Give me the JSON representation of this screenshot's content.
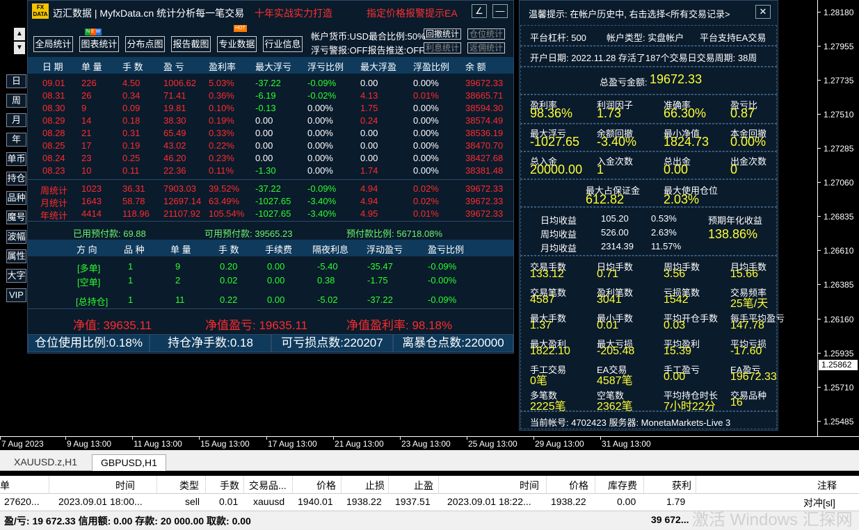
{
  "price_axis": [
    "1.28180",
    "1.27955",
    "1.27735",
    "1.27510",
    "1.27285",
    "1.27060",
    "1.26835",
    "1.26610",
    "1.26385",
    "1.26160",
    "1.25935",
    "1.25710",
    "1.25485"
  ],
  "current_price": "1.25862",
  "time_axis": [
    "7 Aug 2023",
    "9 Aug 13:00",
    "11 Aug 13:00",
    "15 Aug 13:00",
    "17 Aug 13:00",
    "21 Aug 13:00",
    "23 Aug 13:00",
    "25 Aug 13:00",
    "29 Aug 13:00",
    "31 Aug 13:00"
  ],
  "panel": {
    "logo": "FX\nDATA",
    "brand": "迈汇数据 | MyfxData.cn  统计分析每一笔交易",
    "slogan": "十年实战实力打造",
    "ea_link": "指定价格报警提示EA",
    "edit_icon": "∠",
    "min_icon": "—",
    "nav": [
      "全局统计",
      "图表统计",
      "分布点图",
      "报告截图",
      "专业数据",
      "行业信息"
    ],
    "badge_new": "N E W",
    "badge_hot": "HOT",
    "account_currency": "帐户货币:USD最合比例:50%",
    "float_alert": "浮亏警报:OFF报告推送:OFF",
    "btn_withdraw": "回撤统计",
    "btn_position": "仓位统计",
    "btn_interest": "利息统计",
    "btn_rebate": "返佣统计",
    "up_icon": "▲",
    "down_icon": "▼",
    "side": [
      "日",
      "周",
      "月",
      "年",
      "单币",
      "持仓",
      "品种",
      "魔号",
      "波幅",
      "属性",
      "大字",
      "VIP"
    ],
    "columns": [
      "日 期",
      "单 量",
      "手 数",
      "盈 亏",
      "盈利率",
      "最大浮亏",
      "浮亏比例",
      "最大浮盈",
      "浮盈比例",
      "余 额"
    ],
    "daily": [
      [
        "09.01",
        "226",
        "4.50",
        "1006.62",
        "5.03%",
        "-37.22",
        "-0.09%",
        "0.00",
        "0.00%",
        "39672.33"
      ],
      [
        "08.31",
        "26",
        "0.34",
        "71.41",
        "0.36%",
        "-6.19",
        "-0.02%",
        "4.13",
        "0.01%",
        "38665.71"
      ],
      [
        "08.30",
        "9",
        "0.09",
        "19.81",
        "0.10%",
        "-0.13",
        "0.00%",
        "1.75",
        "0.00%",
        "38594.30"
      ],
      [
        "08.29",
        "14",
        "0.18",
        "38.30",
        "0.19%",
        "0.00",
        "0.00%",
        "0.24",
        "0.00%",
        "38574.49"
      ],
      [
        "08.28",
        "21",
        "0.31",
        "65.49",
        "0.33%",
        "0.00",
        "0.00%",
        "0.00",
        "0.00%",
        "38536.19"
      ],
      [
        "08.25",
        "17",
        "0.19",
        "43.02",
        "0.22%",
        "0.00",
        "0.00%",
        "0.00",
        "0.00%",
        "38470.70"
      ],
      [
        "08.24",
        "23",
        "0.25",
        "46.20",
        "0.23%",
        "0.00",
        "0.00%",
        "0.00",
        "0.00%",
        "38427.68"
      ],
      [
        "08.23",
        "10",
        "0.11",
        "22.36",
        "0.11%",
        "-1.30",
        "0.00%",
        "1.74",
        "0.00%",
        "38381.48"
      ]
    ],
    "summary_rows": [
      [
        "周统计",
        "1023",
        "36.31",
        "7903.03",
        "39.52%",
        "-37.22",
        "-0.09%",
        "4.94",
        "0.02%",
        "39672.33"
      ],
      [
        "月统计",
        "1643",
        "58.78",
        "12697.14",
        "63.49%",
        "-1027.65",
        "-3.40%",
        "4.94",
        "0.02%",
        "39672.33"
      ],
      [
        "年统计",
        "4414",
        "118.96",
        "21107.92",
        "105.54%",
        "-1027.65",
        "-3.40%",
        "4.95",
        "0.01%",
        "39672.33"
      ]
    ],
    "margin_used": "已用预付款: 69.88",
    "margin_free": "可用预付款: 39565.23",
    "margin_ratio": "预付款比例: 56718.08%",
    "pos_columns": [
      "方 向",
      "品 种",
      "单 量",
      "手 数",
      "手续费",
      "隔夜利息",
      "浮动盈亏",
      "盈亏比例"
    ],
    "positions": [
      [
        "[多单]",
        "1",
        "9",
        "0.20",
        "0.00",
        "-5.40",
        "-35.47",
        "-0.09%"
      ],
      [
        "[空单]",
        "1",
        "2",
        "0.02",
        "0.00",
        "0.38",
        "-1.75",
        "-0.00%"
      ]
    ],
    "pos_total": [
      "[总持仓]",
      "1",
      "11",
      "0.22",
      "0.00",
      "-5.02",
      "-37.22",
      "-0.09%"
    ],
    "net_value": "净值: 39635.11",
    "net_profit": "净值盈亏: 19635.11",
    "net_rate": "净值盈利率: 98.18%",
    "bottom": [
      "仓位使用比例:0.18%",
      "持仓净手数:0.18",
      "可亏损点数:220207",
      "离暴仓点数:220000"
    ]
  },
  "right": {
    "notice": "温馨提示: 在帐户历史中, 右击选择<所有交易记录>",
    "close_icon": "✕",
    "leverage": "平台杠杆: 500",
    "acct_type": "帐户类型: 实盘帐户",
    "ea_support": "平台支持EA交易",
    "open_date": "开户日期: 2022.11.28 存活了187个交易日交易周期: 38周",
    "total_label": "总盈亏金额:",
    "total_value": "19672.33",
    "grid1": [
      [
        "盈利率",
        "98.36%"
      ],
      [
        "利润因子",
        "1.73"
      ],
      [
        "准确率",
        "66.30%"
      ],
      [
        "盈亏比",
        "0.87"
      ],
      [
        "最大浮亏",
        "-1027.65"
      ],
      [
        "余额回撤",
        "-3.40%"
      ],
      [
        "最小净值",
        "1824.73"
      ],
      [
        "本金回撤",
        "0.00%"
      ],
      [
        "总入金",
        "20000.00"
      ],
      [
        "入金次数",
        "1"
      ],
      [
        "总出金",
        "0.00"
      ],
      [
        "出金次数",
        "0"
      ]
    ],
    "max_margin_label": "最大占保证金",
    "max_margin": "612.82",
    "max_pos_label": "最大使用仓位",
    "max_pos": "2.03%",
    "avg": [
      [
        "日均收益",
        "105.20",
        "0.53%"
      ],
      [
        "周均收益",
        "526.00",
        "2.63%"
      ],
      [
        "月均收益",
        "2314.39",
        "11.57%"
      ]
    ],
    "annual_label": "预期年化收益",
    "annual": "138.86%",
    "grid2": [
      [
        "交易手数",
        "133.12"
      ],
      [
        "日均手数",
        "0.71"
      ],
      [
        "周均手数",
        "3.56"
      ],
      [
        "月均手数",
        "15.66"
      ],
      [
        "交易笔数",
        "4587"
      ],
      [
        "盈利笔数",
        "3041"
      ],
      [
        "亏损笔数",
        "1542"
      ],
      [
        "交易频率",
        "25笔/天"
      ],
      [
        "最大手数",
        "1.37"
      ],
      [
        "最小手数",
        "0.01"
      ],
      [
        "平均开仓手数",
        "0.03"
      ],
      [
        "每手平均盈亏",
        "147.78"
      ],
      [
        "最大盈利",
        "1822.10"
      ],
      [
        "最大亏损",
        "-205.48"
      ],
      [
        "平均盈利",
        "15.39"
      ],
      [
        "平均亏损",
        "-17.60"
      ],
      [
        "手工交易",
        "0笔"
      ],
      [
        "EA交易",
        "4587笔"
      ],
      [
        "手工盈亏",
        "0.00"
      ],
      [
        "EA盈亏",
        "19672.33"
      ],
      [
        "多笔数",
        "2225笔"
      ],
      [
        "空笔数",
        "2362笔"
      ],
      [
        "平均持仓时长",
        "7小时22分"
      ],
      [
        "交易品种",
        "16"
      ]
    ],
    "account": "当前帐号: 4702423 服务器: MonetaMarkets-Live 3"
  },
  "terminal": {
    "tabs": [
      "XAUUSD.z,H1",
      "GBPUSD,H1"
    ],
    "columns": [
      "单",
      "时间",
      "类型",
      "手数",
      "交易品...",
      "价格",
      "止损",
      "止盈",
      "时间",
      "价格",
      "库存费",
      "获利",
      "注释"
    ],
    "row": [
      "27620...",
      "2023.09.01 18:00...",
      "sell",
      "0.01",
      "xauusd",
      "1940.01",
      "1938.22",
      "1937.51",
      "2023.09.01 18:22...",
      "1938.22",
      "0.00",
      "1.79",
      "对冲[sl]"
    ],
    "summary": "盈/亏: 19 672.33  信用额: 0.00  存款: 20 000.00  取款: 0.00",
    "summary_total": "39 672...",
    "watermark": "激活 Windows 汇探网"
  }
}
